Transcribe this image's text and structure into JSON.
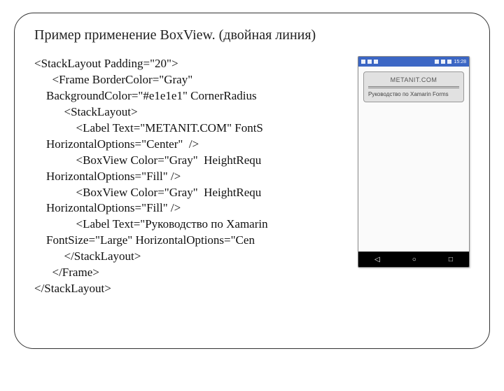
{
  "title": "Пример применение BoxView. (двойная линия)",
  "code": {
    "l1": "<StackLayout Padding=\"20\">",
    "l2": "      <Frame BorderColor=\"Gray\"",
    "l3": "    BackgroundColor=\"#e1e1e1\" CornerRadius",
    "l4": "          <StackLayout>",
    "l5": "              <Label Text=\"METANIT.COM\" FontS",
    "l6": "    HorizontalOptions=\"Center\"  />",
    "l7": "              <BoxView Color=\"Gray\"  HeightRequ",
    "l8": "    HorizontalOptions=\"Fill\" />",
    "l9": "              <BoxView Color=\"Gray\"  HeightRequ",
    "l10": "    HorizontalOptions=\"Fill\" />",
    "l11": "              <Label Text=\"Руководство по Xamarin ",
    "l12": "    FontSize=\"Large\" HorizontalOptions=\"Cen",
    "l13": "          </StackLayout>",
    "l14": "      </Frame>",
    "l15": "</StackLayout>"
  },
  "phone": {
    "statusbar": {
      "time": "15:28"
    },
    "frame": {
      "heading": "METANIT.COM",
      "subtitle": "Руководство по Xamarin Forms"
    },
    "nav": {
      "back": "◁",
      "home": "○",
      "recent": "□"
    }
  }
}
